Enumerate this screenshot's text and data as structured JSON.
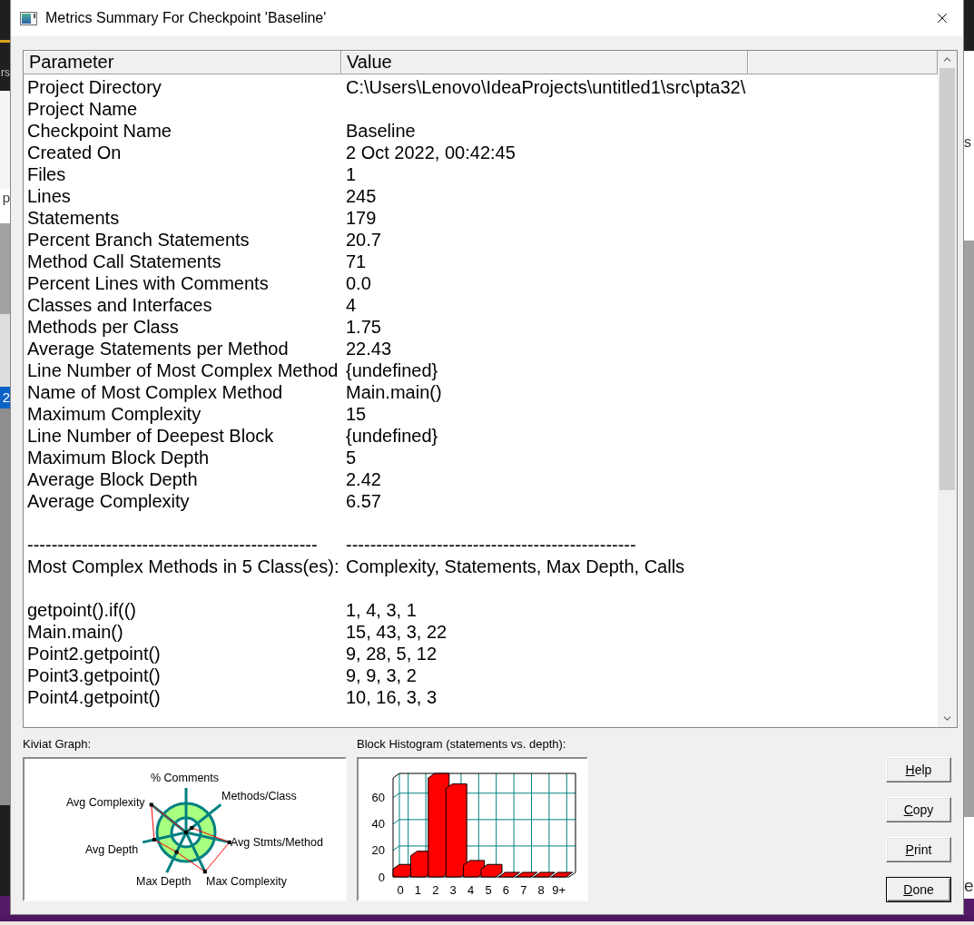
{
  "window": {
    "title": "Metrics Summary For Checkpoint 'Baseline'"
  },
  "table": {
    "columns": [
      "Parameter",
      "Value"
    ],
    "groups": [
      {
        "rows": [
          {
            "parameter": "Project Directory",
            "value": "C:\\Users\\Lenovo\\IdeaProjects\\untitled1\\src\\pta32\\"
          },
          {
            "parameter": "Project Name"
          },
          {
            "parameter": "Checkpoint Name",
            "value": "Baseline"
          },
          {
            "parameter": "Created On",
            "value": "2 Oct 2022, 00:42:45"
          },
          {
            "parameter": "Files",
            "value": "1"
          },
          {
            "parameter": "Lines",
            "value": "245"
          },
          {
            "parameter": "Statements",
            "value": "179"
          },
          {
            "parameter": "Percent Branch Statements",
            "value": "20.7"
          },
          {
            "parameter": "Method Call Statements",
            "value": "71"
          },
          {
            "parameter": "Percent Lines with Comments",
            "value": "0.0"
          },
          {
            "parameter": "Classes and Interfaces",
            "value": "4"
          },
          {
            "parameter": "Methods per Class",
            "value": "1.75"
          },
          {
            "parameter": "Average Statements per Method",
            "value": "22.43"
          },
          {
            "parameter": "Line Number of Most Complex Method",
            "value": "{undefined}"
          },
          {
            "parameter": "Name of Most Complex Method",
            "value": "Main.main()"
          },
          {
            "parameter": "Maximum Complexity",
            "value": "15"
          },
          {
            "parameter": "Line Number of Deepest Block",
            "value": "{undefined}"
          },
          {
            "parameter": "Maximum Block Depth",
            "value": "5"
          },
          {
            "parameter": "Average Block Depth",
            "value": "2.42"
          },
          {
            "parameter": "Average Complexity",
            "value": "6.57"
          }
        ]
      },
      {
        "rows": [
          {
            "parameter": "------------------------------------------------",
            "value": "------------------------------------------------"
          },
          {
            "parameter": "Most Complex Methods in 5 Class(es):",
            "value": "Complexity, Statements, Max Depth, Calls"
          }
        ]
      },
      {
        "rows": [
          {
            "parameter": "getpoint().if(()",
            "value": "1, 4, 3, 1"
          },
          {
            "parameter": "Main.main()",
            "value": "15, 43, 3, 22"
          },
          {
            "parameter": "Point2.getpoint()",
            "value": "9, 28, 5, 12"
          },
          {
            "parameter": "Point3.getpoint()",
            "value": "9, 9, 3, 2"
          },
          {
            "parameter": "Point4.getpoint()",
            "value": "10, 16, 3, 3"
          }
        ]
      }
    ]
  },
  "kiviat": {
    "label": "Kiviat Graph:",
    "axes": [
      "% Comments",
      "Avg Complexity",
      "Methods/Class",
      "Avg Depth",
      "Avg Stmts/Method",
      "Max Depth",
      "Max Complexity"
    ]
  },
  "histogram": {
    "label": "Block Histogram (statements vs. depth):",
    "chart_data": {
      "type": "bar",
      "categories": [
        "0",
        "1",
        "2",
        "3",
        "4",
        "5",
        "6",
        "7",
        "8",
        "9+"
      ],
      "values": [
        6,
        16,
        75,
        67,
        9,
        6,
        0,
        0,
        0,
        0
      ],
      "ylim": [
        0,
        75
      ],
      "yticks": [
        0,
        20,
        40,
        60
      ],
      "grid": true
    }
  },
  "buttons": [
    {
      "label": "Help",
      "default": false
    },
    {
      "label": "Copy",
      "default": false
    },
    {
      "label": "Print",
      "default": false
    },
    {
      "label": "Done",
      "default": true
    }
  ],
  "background": {
    "left_edge": [
      "rs",
      "p",
      "2"
    ],
    "right_edge": [
      "s",
      "e"
    ]
  }
}
